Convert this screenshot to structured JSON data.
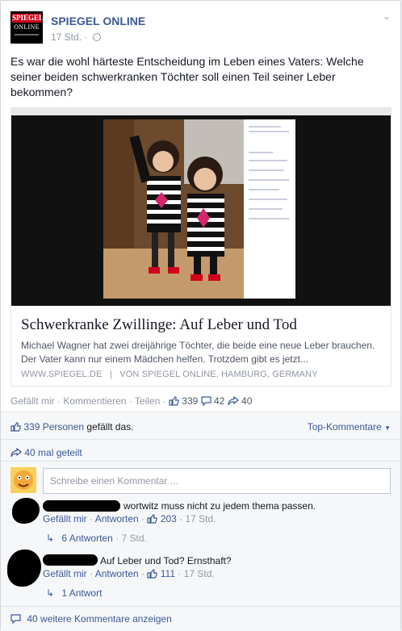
{
  "post": {
    "page_name": "SPIEGEL ONLINE",
    "logo_line1": "SPIEGEL",
    "logo_line2": "ONLINE",
    "time": "17 Std.",
    "text": "Es war die wohl härteste Entscheidung im Leben eines Vaters: Welche seiner beiden schwerkranken Töchter soll einen Teil seiner Leber bekommen?"
  },
  "link": {
    "title": "Schwerkranke Zwillinge: Auf Leber und Tod",
    "description": "Michael Wagner hat zwei dreijährige Töchter, die beide eine neue Leber brauchen. Der Vater kann nur einem Mädchen helfen. Trotzdem gibt es jetzt...",
    "source": "WWW.SPIEGEL.DE   |   VON SPIEGEL ONLINE, HAMBURG, GERMANY"
  },
  "actions": {
    "like": "Gefällt mir",
    "comment": "Kommentieren",
    "share": "Teilen",
    "likes_count": "339",
    "comments_count": "42",
    "shares_count": "40"
  },
  "ufi": {
    "likes_people": "339 Personen",
    "likes_suffix": "gefällt das.",
    "top_comments": "Top-Kommentare",
    "shares": "40 mal geteilt",
    "comment_placeholder": "Schreibe einen Kommentar ...",
    "more_comments": "40 weitere Kommentare anzeigen"
  },
  "comments": [
    {
      "text": "wortwitz muss nicht zu jedem thema passen.",
      "like": "Gefällt mir",
      "reply": "Antworten",
      "likes": "203",
      "time": "17 Std.",
      "replies": "6 Antworten",
      "replies_time": "7 Std."
    },
    {
      "text": "Auf Leber und Tod? Ernsthaft?",
      "like": "Gefällt mir",
      "reply": "Antworten",
      "likes": "111",
      "time": "17 Std.",
      "replies": "1 Antwort",
      "replies_time": ""
    }
  ],
  "colors": {
    "link_blue": "#3b5998",
    "grey_text": "#9197a3",
    "ufi_bg": "#f6f7f8"
  }
}
